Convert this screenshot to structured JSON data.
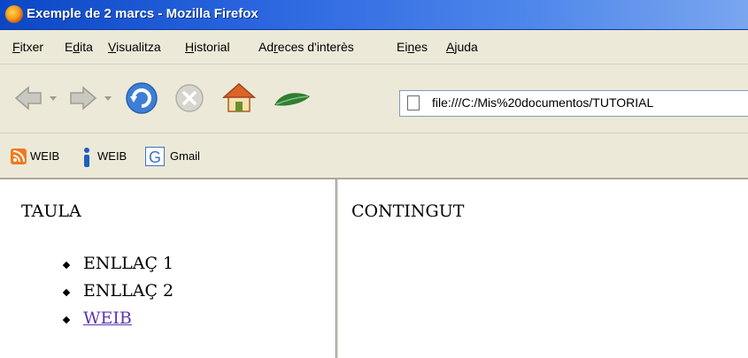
{
  "window": {
    "title": "Exemple de 2 marcs - Mozilla Firefox",
    "accent": "#0b47c4"
  },
  "menu": {
    "items": [
      {
        "pre": "",
        "u": "F",
        "post": "itxer"
      },
      {
        "pre": "E",
        "u": "d",
        "post": "ita"
      },
      {
        "pre": "",
        "u": "V",
        "post": "isualitza"
      },
      {
        "pre": "",
        "u": "H",
        "post": "istorial"
      },
      {
        "pre": "Ad",
        "u": "r",
        "post": "eces d'interès"
      },
      {
        "pre": "Ei",
        "u": "n",
        "post": "es"
      },
      {
        "pre": "",
        "u": "A",
        "post": "juda"
      }
    ]
  },
  "navigation": {
    "buttons": [
      "back-icon",
      "forward-icon",
      "reload-icon",
      "stop-icon",
      "home-icon",
      "leaf-icon"
    ],
    "url": "file:///C:/Mis%20documentos/TUTORIAL"
  },
  "bookmarks": {
    "items": [
      {
        "label": "WEIB",
        "icon": "rss-icon"
      },
      {
        "label": "WEIB",
        "icon": "info-icon"
      },
      {
        "label": "Gmail",
        "icon": "google-icon"
      }
    ]
  },
  "left_frame": {
    "heading": "TAULA",
    "links": [
      "ENLLAÇ 1",
      "ENLLAÇ 2",
      "WEIB"
    ],
    "link_color": "#5e35b1"
  },
  "right_frame": {
    "heading": "CONTINGUT"
  }
}
